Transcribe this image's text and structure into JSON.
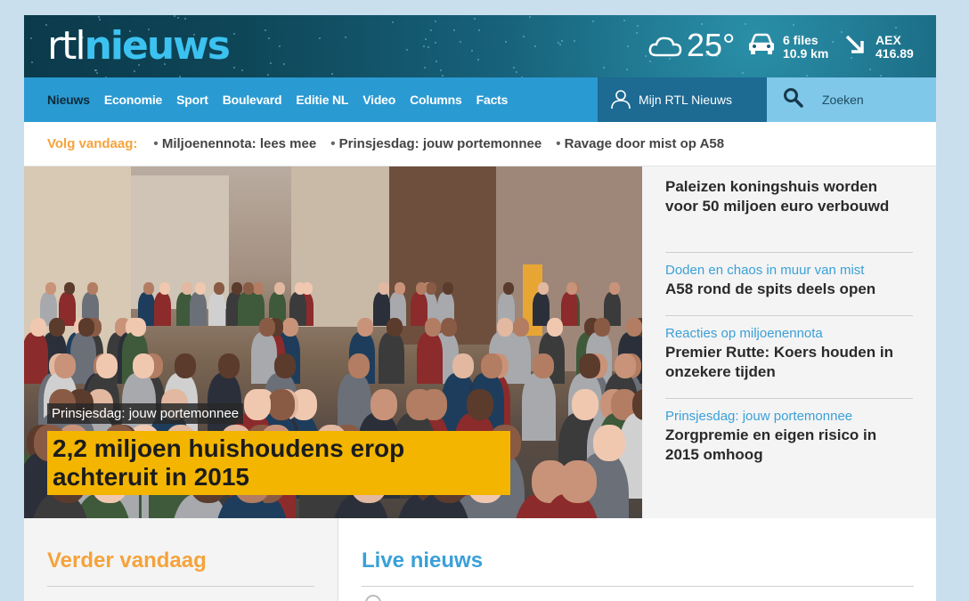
{
  "header": {
    "logo_part1": "rtl",
    "logo_part2": "nieuws",
    "temperature": "25°",
    "traffic_count": "6 files",
    "traffic_length": "10.9 km",
    "aex_label": "AEX",
    "aex_value": "416.89",
    "weather_icon": "cloud-icon",
    "traffic_icon": "car-icon",
    "aex_icon": "arrow-down-right-icon"
  },
  "nav": {
    "items": [
      {
        "label": "Nieuws",
        "active": true
      },
      {
        "label": "Economie"
      },
      {
        "label": "Sport"
      },
      {
        "label": "Boulevard"
      },
      {
        "label": "Editie NL"
      },
      {
        "label": "Video"
      },
      {
        "label": "Columns"
      },
      {
        "label": "Facts"
      }
    ],
    "mijn_label": "Mijn RTL Nieuws",
    "search_placeholder": "Zoeken"
  },
  "volg": {
    "label": "Volg vandaag:",
    "links": [
      "Miljoenennota: lees mee",
      "Prinsjesdag: jouw portemonnee",
      "Ravage door mist op A58"
    ]
  },
  "hero": {
    "tag": "Prinsjesdag: jouw portemonnee",
    "title": "2,2 miljoen huishoudens erop achteruit in 2015"
  },
  "side": [
    {
      "kicker": "",
      "headline": "Paleizen koningshuis worden voor 50 miljoen euro verbouwd"
    },
    {
      "kicker": "Doden en chaos in muur van mist",
      "headline": "A58 rond de spits deels open"
    },
    {
      "kicker": "Reacties op miljoenennota",
      "headline": "Premier Rutte: Koers houden in onzekere tijden"
    },
    {
      "kicker": "Prinsjesdag: jouw portemonnee",
      "headline": "Zorgpremie en eigen risico in 2015 omhoog"
    }
  ],
  "bottom": {
    "verder": "Verder vandaag",
    "live": "Live nieuws"
  },
  "colors": {
    "accent_blue": "#2a9ad2",
    "accent_orange": "#f5a33b",
    "hero_title_bg": "#f3b500"
  }
}
